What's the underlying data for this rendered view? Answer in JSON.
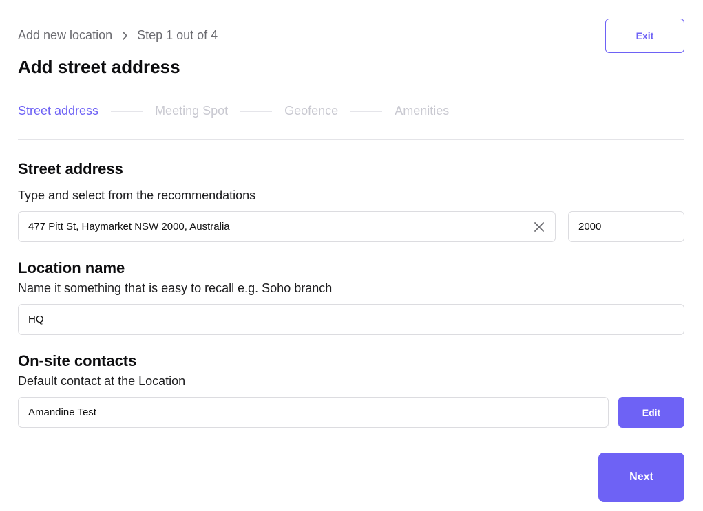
{
  "header": {
    "breadcrumb_parent": "Add new location",
    "breadcrumb_step": "Step 1 out of 4",
    "title": "Add street address",
    "exit_label": "Exit"
  },
  "stepper": {
    "steps": [
      {
        "label": "Street address",
        "active": true
      },
      {
        "label": "Meeting Spot",
        "active": false
      },
      {
        "label": "Geofence",
        "active": false
      },
      {
        "label": "Amenities",
        "active": false
      }
    ]
  },
  "street": {
    "title": "Street address",
    "description": "Type and select from the recommendations",
    "address_value": "477 Pitt St, Haymarket NSW 2000, Australia",
    "postcode_value": "2000"
  },
  "location": {
    "title": "Location name",
    "description": "Name it something that is easy to recall e.g. Soho branch",
    "name_value": "HQ"
  },
  "contacts": {
    "title": "On-site contacts",
    "description": "Default contact at the Location",
    "contact_value": "Amandine Test",
    "edit_label": "Edit"
  },
  "footer": {
    "next_label": "Next"
  },
  "colors": {
    "accent": "#6e62f5",
    "inactive_step": "#c9c9d1",
    "border": "#dcdce0"
  },
  "icons": {
    "breadcrumb_separator": "chevron-right-icon",
    "clear_address": "close-icon"
  }
}
